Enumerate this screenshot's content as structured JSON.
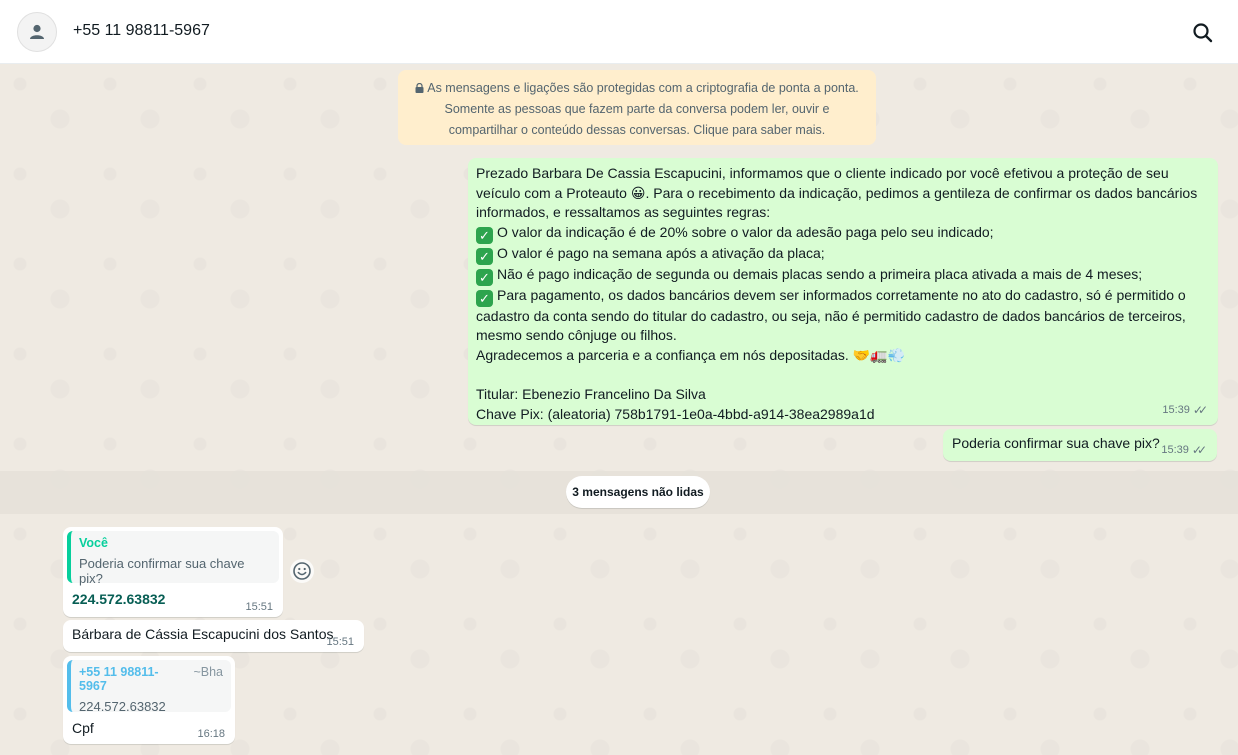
{
  "header": {
    "contact": "+55 11 98811-5967"
  },
  "encryption_notice": "As mensagens e ligações são protegidas com a criptografia de ponta a ponta. Somente as pessoas que fazem parte da conversa podem ler, ouvir e compartilhar o conteúdo dessas conversas. Clique para saber mais.",
  "messages": {
    "out1": {
      "intro": "Prezado Barbara De Cassia Escapucini, informamos que o cliente indicado por você efetivou a proteção de seu veículo com a Proteauto 😀. Para o recebimento da indicação, pedimos a gentileza de confirmar os dados bancários informados, e  ressaltamos as seguintes regras:",
      "rules": [
        "O valor da indicação é de 20% sobre o valor da adesão paga pelo seu indicado;",
        "O valor é pago na semana após a ativação da placa;",
        "Não é pago indicação de segunda ou demais placas sendo a primeira placa ativada a mais de 4 meses;",
        "Para pagamento, os dados bancários devem ser informados corretamente no ato do cadastro, só é permitido o cadastro da conta sendo do titular do cadastro, ou seja, não é permitido cadastro de dados bancários de terceiros, mesmo sendo cônjuge ou filhos."
      ],
      "thanks": "Agradecemos a parceria e a confiança em nós depositadas. 🤝🚛💨",
      "holder": "Titular: Ebenezio Francelino Da Silva",
      "pix": "Chave Pix: (aleatoria) 758b1791-1e0a-4bbd-a914-38ea2989a1d",
      "time": "15:39"
    },
    "out2": {
      "text": "Poderia confirmar sua chave pix?",
      "time": "15:39"
    },
    "unread_label": "3 mensagens não lidas",
    "in1": {
      "quote_author": "Você",
      "quote_text": "Poderia confirmar sua chave pix?",
      "text": "224.572.63832",
      "time": "15:51"
    },
    "in2": {
      "text": "Bárbara de Cássia Escapucini dos Santos",
      "time": "15:51"
    },
    "in3": {
      "quote_number": "+55 11 98811-5967",
      "quote_alias": "~Bha",
      "quote_text": "224.572.63832",
      "text": "Cpf",
      "time": "16:18"
    }
  }
}
